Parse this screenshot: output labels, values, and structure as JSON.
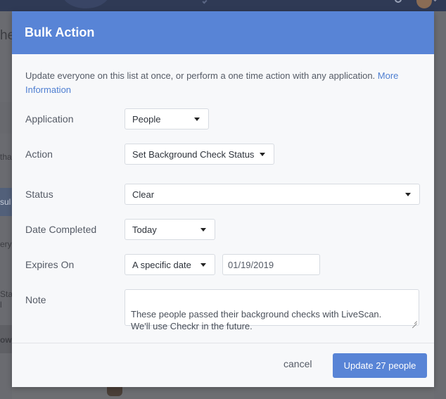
{
  "modal": {
    "title": "Bulk Action",
    "intro": "Update everyone on this list at once, or perform a one time action with any application.",
    "intro_link": "More Information"
  },
  "form": {
    "application": {
      "label": "Application",
      "value": "People"
    },
    "action": {
      "label": "Action",
      "value": "Set Background Check Status"
    },
    "status": {
      "label": "Status",
      "value": "Clear"
    },
    "date_completed": {
      "label": "Date Completed",
      "value": "Today"
    },
    "expires_on": {
      "label": "Expires On",
      "mode": "A specific date",
      "date": "01/19/2019"
    },
    "note": {
      "label": "Note",
      "value": "These people passed their background checks with LiveScan.\nWe'll use Checkr in the future."
    }
  },
  "footer": {
    "cancel_label": "cancel",
    "submit_label": "Update 27 people"
  },
  "background": {
    "fragments": [
      "he",
      "tha",
      "sul",
      "ery",
      "Sta",
      "l",
      "ow"
    ]
  },
  "colors": {
    "accent": "#5884d6",
    "header_bg": "#5884d6",
    "link": "#4f7fd1",
    "text": "#555b66",
    "overlay": "#6e6f73"
  },
  "icons": {
    "dropdown": "caret-down-icon",
    "resize": "resize-grip-icon"
  }
}
